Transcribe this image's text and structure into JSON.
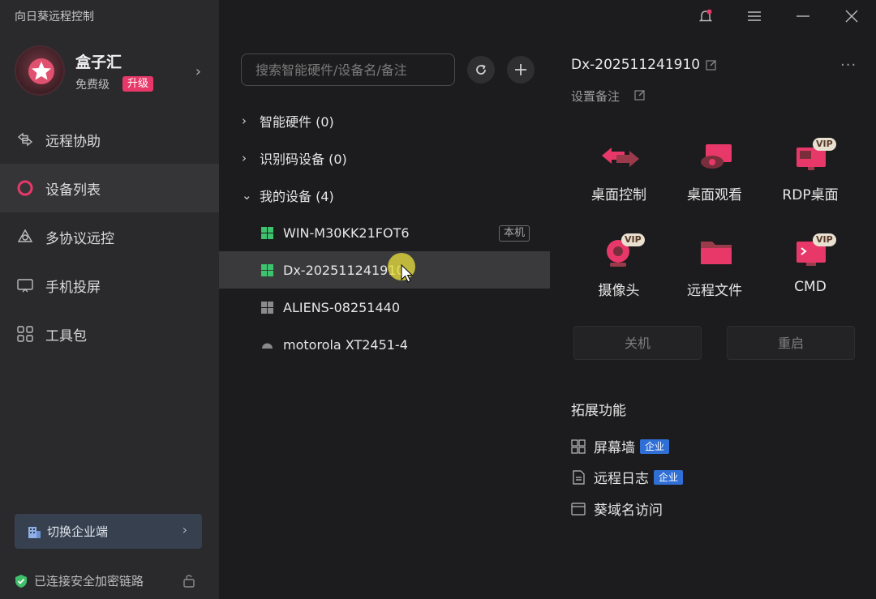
{
  "app": {
    "title": "向日葵远程控制"
  },
  "profile": {
    "name": "盒子汇",
    "tier": "免费级",
    "upgrade": "升级"
  },
  "nav": {
    "items": [
      {
        "label": "远程协助",
        "icon": "remote-assist-icon"
      },
      {
        "label": "设备列表",
        "icon": "device-list-icon",
        "active": true
      },
      {
        "label": "多协议远控",
        "icon": "multi-protocol-icon"
      },
      {
        "label": "手机投屏",
        "icon": "phone-cast-icon"
      },
      {
        "label": "工具包",
        "icon": "toolkit-icon"
      }
    ]
  },
  "sidebar_footer": {
    "switch_enterprise": "切换企业端",
    "secure_status": "已连接安全加密链路"
  },
  "search": {
    "placeholder": "搜索智能硬件/设备名/备注"
  },
  "tree": {
    "groups": [
      {
        "label": "智能硬件 (0)",
        "expanded": false
      },
      {
        "label": "识别码设备 (0)",
        "expanded": false
      },
      {
        "label": "我的设备 (4)",
        "expanded": true
      }
    ],
    "devices": [
      {
        "name": "WIN-M30KK21FOT6",
        "tag": "本机",
        "os": "windows"
      },
      {
        "name": "Dx-202511241910",
        "os": "windows",
        "selected": true
      },
      {
        "name": "ALIENS-08251440",
        "os": "windows"
      },
      {
        "name": "motorola XT2451-4",
        "os": "android"
      }
    ]
  },
  "detail": {
    "title": "Dx-202511241910",
    "remark": "设置备注",
    "functions": [
      {
        "label": "桌面控制",
        "icon": "desktop-control-icon",
        "vip": ""
      },
      {
        "label": "桌面观看",
        "icon": "desktop-view-icon",
        "vip": ""
      },
      {
        "label": "RDP桌面",
        "icon": "rdp-desktop-icon",
        "vip": "VIP"
      },
      {
        "label": "摄像头",
        "icon": "camera-icon",
        "vip": "VIP"
      },
      {
        "label": "远程文件",
        "icon": "remote-file-icon",
        "vip": ""
      },
      {
        "label": "CMD",
        "icon": "cmd-icon",
        "vip": "VIP"
      }
    ],
    "shutdown": "关机",
    "restart": "重启",
    "ext_title": "拓展功能",
    "ext_items": [
      {
        "label": "屏幕墙",
        "badge": "企业"
      },
      {
        "label": "远程日志",
        "badge": "企业"
      },
      {
        "label": "葵域名访问",
        "badge": ""
      }
    ]
  },
  "colors": {
    "accent": "#e8386a",
    "enterprise": "#2f6fd6",
    "windows_green": "#3ec26d"
  }
}
